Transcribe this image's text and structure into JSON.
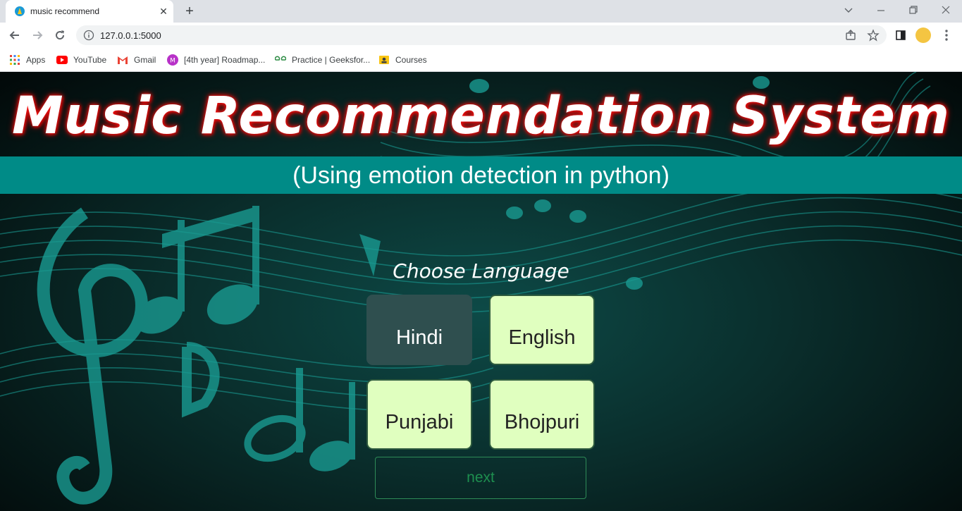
{
  "browser": {
    "tab_title": "music recommend",
    "url": "127.0.0.1:5000",
    "bookmarks": [
      {
        "label": "Apps",
        "icon": "apps-grid-icon"
      },
      {
        "label": "YouTube",
        "icon": "youtube-icon"
      },
      {
        "label": "Gmail",
        "icon": "gmail-icon"
      },
      {
        "label": "[4th year] Roadmap...",
        "icon": "m-badge-icon"
      },
      {
        "label": "Practice | Geeksfor...",
        "icon": "gfg-icon"
      },
      {
        "label": "Courses",
        "icon": "courses-icon"
      }
    ]
  },
  "page": {
    "title": "Music Recommendation System",
    "subtitle": "(Using emotion detection in python)",
    "choose_label": "Choose Language",
    "languages": [
      {
        "label": "Hindi",
        "selected": true
      },
      {
        "label": "English",
        "selected": false
      },
      {
        "label": "Punjabi",
        "selected": false
      },
      {
        "label": "Bhojpuri",
        "selected": false
      }
    ],
    "next_label": "next"
  },
  "colors": {
    "accent_band": "#008b87",
    "button_bg": "#e0ffbf",
    "selected_bg": "#2f4f4f",
    "next_text": "#1e8f4f"
  }
}
